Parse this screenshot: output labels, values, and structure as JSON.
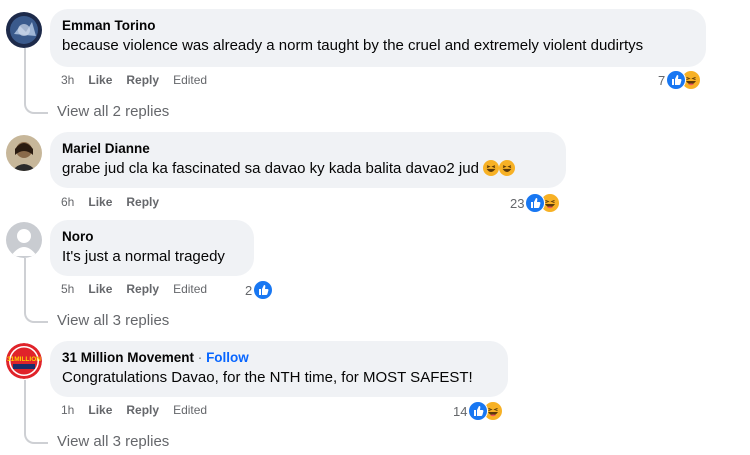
{
  "comments": [
    {
      "author": "Emman Torino",
      "text": "because violence was already a norm taught by the cruel and extremely violent dudirtys",
      "time": "3h",
      "like": "Like",
      "reply": "Reply",
      "edited": "Edited",
      "reaction_count": "7",
      "reactions": [
        "like-icon",
        "haha-icon"
      ],
      "view_replies": "View all 2 replies"
    },
    {
      "author": "Mariel Dianne",
      "text": "grabe jud cla ka fascinated sa davao ky kada balita davao2 jud",
      "text_emojis": [
        "haha-emoji",
        "haha-emoji"
      ],
      "time": "6h",
      "like": "Like",
      "reply": "Reply",
      "reaction_count": "23",
      "reactions": [
        "like-icon",
        "haha-icon"
      ]
    },
    {
      "author": "Noro",
      "text": "It's just a normal tragedy",
      "time": "5h",
      "like": "Like",
      "reply": "Reply",
      "edited": "Edited",
      "reaction_count": "2",
      "reactions": [
        "like-icon"
      ],
      "view_replies": "View all 3 replies"
    },
    {
      "author": "31 Million Movement",
      "follow_separator": "·",
      "follow": "Follow",
      "avatar_text": "31MILLION",
      "text": "Congratulations Davao, for the NTH time, for MOST SAFEST!",
      "time": "1h",
      "like": "Like",
      "reply": "Reply",
      "edited": "Edited",
      "reaction_count": "14",
      "reactions": [
        "like-icon",
        "haha-icon"
      ],
      "view_replies": "View all 3 replies"
    }
  ],
  "colors": {
    "bubble": "#f0f2f5",
    "meta": "#65676b",
    "like_blue": "#1877f2",
    "haha_yellow": "#f7b125",
    "follow_blue": "#0866ff"
  }
}
